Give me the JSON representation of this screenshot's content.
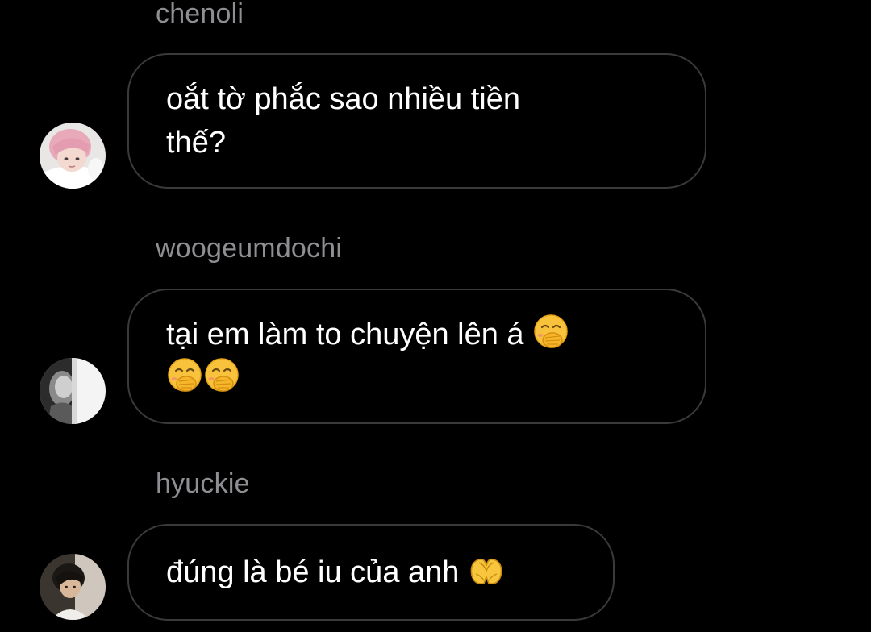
{
  "messages": [
    {
      "sender": "chenoli",
      "text_line1": "oắt tờ phắc sao nhiều tiền",
      "text_line2": "thế?",
      "avatar_icon": "pink-hair-avatar"
    },
    {
      "sender": "woogeumdochi",
      "text_line1": "tại em làm to chuyện lên á",
      "text_line2": "",
      "emoji_icon": "face-with-hand-over-mouth",
      "avatar_icon": "grayscale-portrait-avatar"
    },
    {
      "sender": "hyuckie",
      "text_line1": "đúng là bé iu của anh",
      "emoji_icon": "heart-hands",
      "avatar_icon": "dark-portrait-avatar"
    }
  ],
  "colors": {
    "background": "#000000",
    "bubble_border": "#3a3a3c",
    "sender_text": "#8e8e93",
    "message_text": "#ffffff"
  }
}
